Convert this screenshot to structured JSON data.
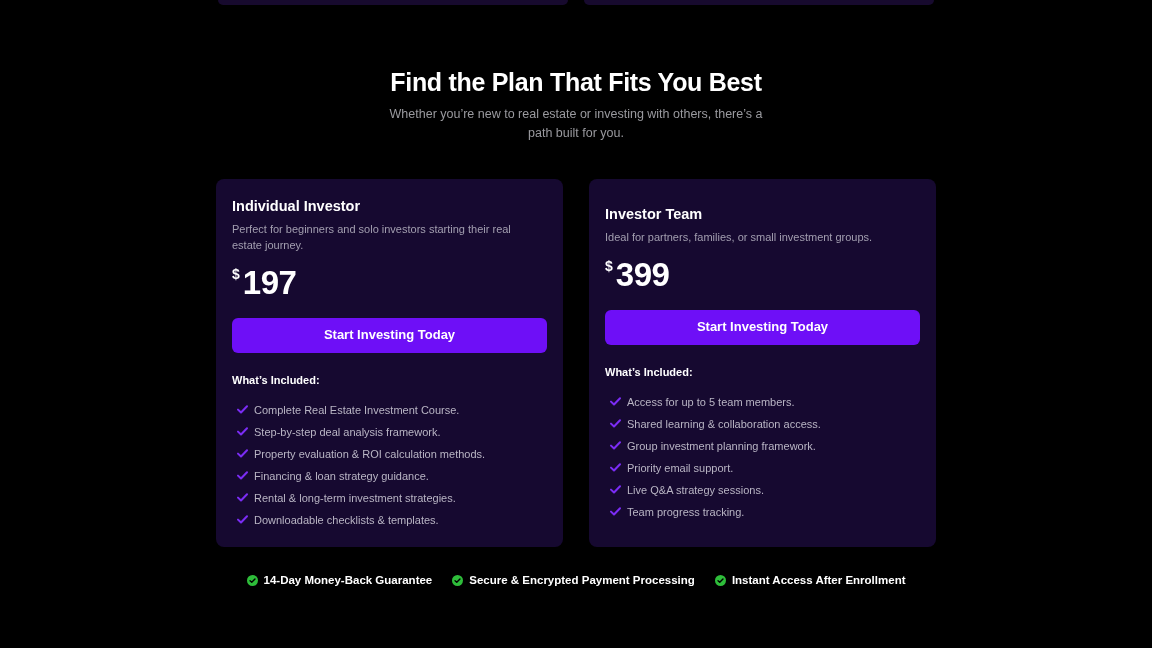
{
  "section": {
    "title": "Find the Plan That Fits You Best",
    "subtitle": "Whether you’re new to real estate or investing with others, there’s a path built for you."
  },
  "plans": [
    {
      "name": "Individual Investor",
      "description": "Perfect for beginners and solo investors starting their real estate journey.",
      "currency": "$",
      "price": "197",
      "button": "Start Investing Today",
      "included_label": "What’s Included:",
      "features": [
        "Complete Real Estate Investment Course.",
        "Step-by-step deal analysis framework.",
        "Property evaluation & ROI calculation methods.",
        "Financing & loan strategy guidance.",
        "Rental & long-term investment strategies.",
        "Downloadable checklists & templates."
      ]
    },
    {
      "name": "Investor Team",
      "description": "Ideal for partners, families, or small investment groups.",
      "currency": "$",
      "price": "399",
      "button": "Start Investing Today",
      "included_label": "What’s Included:",
      "features": [
        "Access for up to 5 team members.",
        "Shared learning & collaboration access.",
        "Group investment planning framework.",
        "Priority email support.",
        "Live Q&A strategy sessions.",
        "Team progress tracking."
      ]
    }
  ],
  "guarantees": [
    "14-Day Money-Back Guarantee",
    "Secure & Encrypted Payment Processing",
    "Instant Access After Enrollment"
  ]
}
